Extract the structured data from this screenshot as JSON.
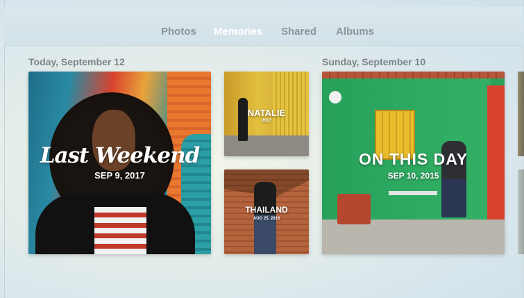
{
  "nav": {
    "tabs": [
      {
        "label": "Photos"
      },
      {
        "label": "Memories"
      },
      {
        "label": "Shared"
      },
      {
        "label": "Albums"
      }
    ],
    "active_tab": "Memories"
  },
  "sections": [
    {
      "date": "Today, September 12",
      "memories": [
        {
          "title": "Last Weekend",
          "subtitle": "SEP 9, 2017"
        },
        {
          "title": "NATALIE",
          "subtitle": "2017"
        },
        {
          "title": "THAILAND",
          "subtitle": "AUG 25, 2016"
        }
      ]
    },
    {
      "date": "Sunday, September 10",
      "memories": [
        {
          "title": "ON THIS DAY",
          "subtitle": "SEP 10, 2015"
        }
      ]
    }
  ]
}
